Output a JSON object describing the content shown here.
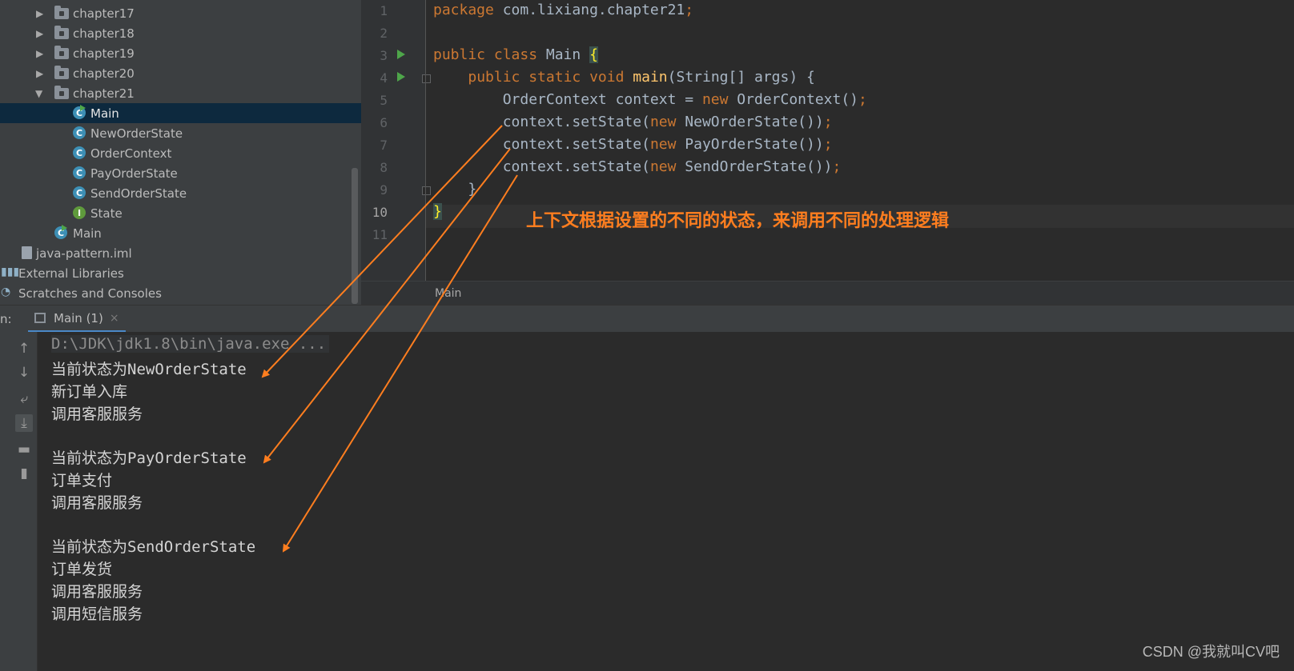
{
  "project_tree": {
    "items": [
      {
        "label": "chapter17",
        "kind": "folder",
        "expanded": false
      },
      {
        "label": "chapter18",
        "kind": "folder",
        "expanded": false
      },
      {
        "label": "chapter19",
        "kind": "folder",
        "expanded": false
      },
      {
        "label": "chapter20",
        "kind": "folder",
        "expanded": false
      },
      {
        "label": "chapter21",
        "kind": "folder",
        "expanded": true
      },
      {
        "label": "Main",
        "kind": "class",
        "selected": true
      },
      {
        "label": "NewOrderState",
        "kind": "class"
      },
      {
        "label": "OrderContext",
        "kind": "class"
      },
      {
        "label": "PayOrderState",
        "kind": "class"
      },
      {
        "label": "SendOrderState",
        "kind": "class"
      },
      {
        "label": "State",
        "kind": "interface"
      },
      {
        "label": "Main",
        "kind": "class"
      },
      {
        "label": "java-pattern.iml",
        "kind": "file"
      },
      {
        "label": "External Libraries",
        "kind": "library"
      },
      {
        "label": "Scratches and Consoles",
        "kind": "scratch"
      }
    ]
  },
  "editor": {
    "line_numbers": [
      "1",
      "2",
      "3",
      "4",
      "5",
      "6",
      "7",
      "8",
      "9",
      "10",
      "11"
    ],
    "current_line": "10",
    "code": {
      "l1_kw": "package",
      "l1_rest": " com.lixiang.chapter21",
      "l1_semi": ";",
      "l3_kw": "public class",
      "l3_name": " Main ",
      "l3_brace": "{",
      "l4_indent": "    ",
      "l4_kw": "public static void",
      "l4_fn": "main",
      "l4_rest": "(String[] args) {",
      "l5_pre": "        OrderContext context = ",
      "l5_kw": "new",
      "l5_post": " OrderContext()",
      "l5_semi": ";",
      "l6_pre": "        context.setState(",
      "l6_kw": "new",
      "l6_post": " NewOrderState())",
      "l6_semi": ";",
      "l7_pre": "        context.setState(",
      "l7_kw": "new",
      "l7_post": " PayOrderState())",
      "l7_semi": ";",
      "l8_pre": "        context.setState(",
      "l8_kw": "new",
      "l8_post": " SendOrderState())",
      "l8_semi": ";",
      "l9": "    }",
      "l10_brace": "}"
    },
    "annotation": "上下文根据设置的不同的状态，来调用不同的处理逻辑",
    "breadcrumb": "Main"
  },
  "run_panel": {
    "prefix": "n:",
    "tab_label": "Main (1)",
    "tab_close": "×",
    "toolbar_icons": [
      "arrow-up-icon",
      "arrow-down-icon",
      "soft-wrap-icon",
      "scroll-to-end-icon",
      "print-icon",
      "trash-icon"
    ],
    "console_lines": [
      "D:\\JDK\\jdk1.8\\bin\\java.exe ...",
      "当前状态为NewOrderState",
      "新订单入库",
      "调用客服服务",
      "当前状态为PayOrderState",
      "订单支付",
      "调用客服服务",
      "当前状态为SendOrderState",
      "订单发货",
      "调用客服服务",
      "调用短信服务"
    ]
  },
  "watermark": "CSDN @我就叫CV吧",
  "colors": {
    "annotation": "#ff7e1f",
    "keyword": "#cc7832",
    "function": "#ffc66d",
    "selection": "#0d293e"
  }
}
